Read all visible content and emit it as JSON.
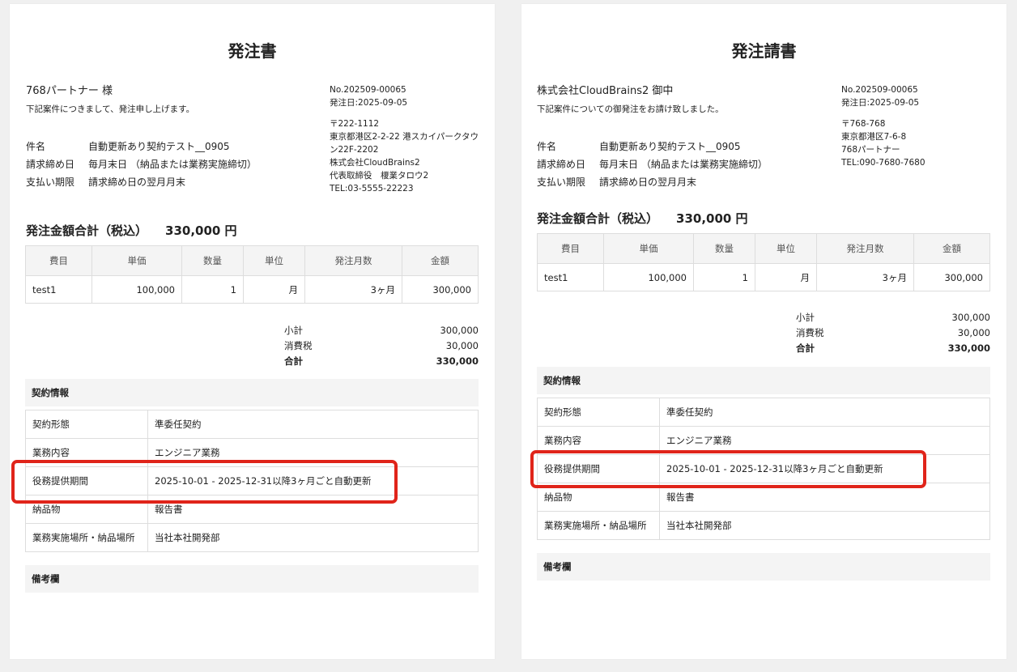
{
  "left": {
    "title": "発注書",
    "recipient": "768パートナー 様",
    "intro": "下記案件につきまして、発注申し上げます。",
    "info": [
      {
        "label": "件名",
        "value": "自動更新あり契約テスト__0905"
      },
      {
        "label": "請求締め日",
        "value": "毎月末日 （納品または業務実施締切）"
      },
      {
        "label": "支払い期限",
        "value": "請求締め日の翌月月末"
      }
    ],
    "doc_no": "No.202509-00065",
    "order_date": "発注日:2025-09-05",
    "postal": "〒222-1112",
    "address": "東京都港区2-2-22 港スカイパークタウン22F-2202",
    "company": "株式会社CloudBrains2",
    "rep": "代表取締役　榎業タロウ2",
    "tel": "TEL:03-5555-22223",
    "total_label": "発注金額合計（税込）",
    "total_value": "330,000 円",
    "table": {
      "headers": [
        "費目",
        "単価",
        "数量",
        "単位",
        "発注月数",
        "金額"
      ],
      "row": [
        "test1",
        "100,000",
        "1",
        "月",
        "3ヶ月",
        "300,000"
      ]
    },
    "subtotal_label": "小計",
    "subtotal": "300,000",
    "tax_label": "消費税",
    "tax": "30,000",
    "grand_label": "合計",
    "grand": "330,000",
    "contract_title": "契約情報",
    "contract": [
      {
        "k": "契約形態",
        "v": "準委任契約"
      },
      {
        "k": "業務内容",
        "v": "エンジニア業務"
      },
      {
        "k": "役務提供期間",
        "v": "2025-10-01 - 2025-12-31以降3ヶ月ごと自動更新"
      },
      {
        "k": "納品物",
        "v": "報告書"
      },
      {
        "k": "業務実施場所・納品場所",
        "v": "当社本社開発部"
      }
    ],
    "remarks_title": "備考欄"
  },
  "right": {
    "title": "発注請書",
    "recipient": "株式会社CloudBrains2 御中",
    "intro": "下記案件についての御発注をお請け致しました。",
    "info": [
      {
        "label": "件名",
        "value": "自動更新あり契約テスト__0905"
      },
      {
        "label": "請求締め日",
        "value": "毎月末日 （納品または業務実施締切）"
      },
      {
        "label": "支払い期限",
        "value": "請求締め日の翌月月末"
      }
    ],
    "doc_no": "No.202509-00065",
    "order_date": "発注日:2025-09-05",
    "postal": "〒768-768",
    "address": "東京都港区7-6-8",
    "company": "768パートナー",
    "tel": "TEL:090-7680-7680",
    "total_label": "発注金額合計（税込）",
    "total_value": "330,000 円",
    "table": {
      "headers": [
        "費目",
        "単価",
        "数量",
        "単位",
        "発注月数",
        "金額"
      ],
      "row": [
        "test1",
        "100,000",
        "1",
        "月",
        "3ヶ月",
        "300,000"
      ]
    },
    "subtotal_label": "小計",
    "subtotal": "300,000",
    "tax_label": "消費税",
    "tax": "30,000",
    "grand_label": "合計",
    "grand": "330,000",
    "contract_title": "契約情報",
    "contract": [
      {
        "k": "契約形態",
        "v": "準委任契約"
      },
      {
        "k": "業務内容",
        "v": "エンジニア業務"
      },
      {
        "k": "役務提供期間",
        "v": "2025-10-01 - 2025-12-31以降3ヶ月ごと自動更新"
      },
      {
        "k": "納品物",
        "v": "報告書"
      },
      {
        "k": "業務実施場所・納品場所",
        "v": "当社本社開発部"
      }
    ],
    "remarks_title": "備考欄"
  },
  "colors": {
    "highlight": "#e0241a",
    "header_bg": "#f4f4f4",
    "border": "#dddddd"
  }
}
